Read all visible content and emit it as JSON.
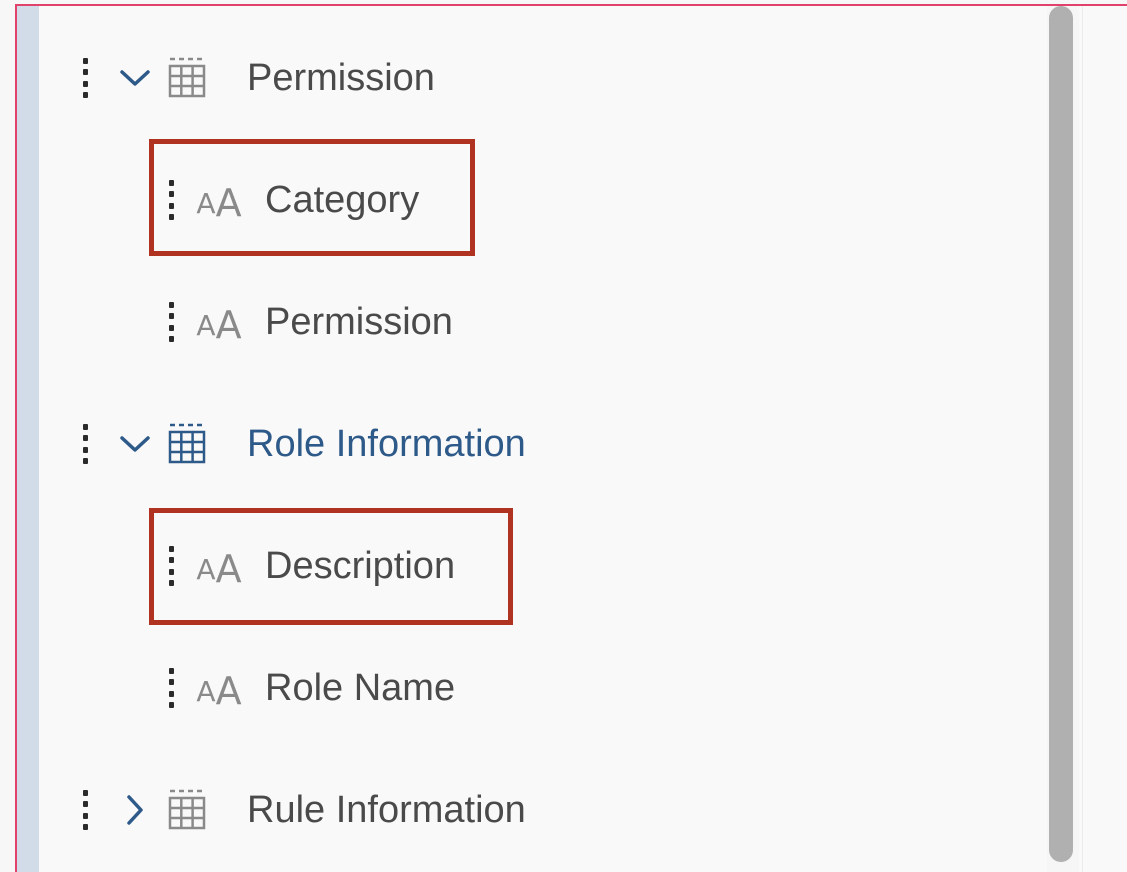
{
  "tree": {
    "items": [
      {
        "label": "Permission",
        "type": "table",
        "expanded": true,
        "color": "#4a4a4a"
      },
      {
        "label": "Category",
        "type": "text",
        "highlighted": true
      },
      {
        "label": "Permission",
        "type": "text"
      },
      {
        "label": "Role Information",
        "type": "table",
        "expanded": true,
        "color": "#2e5a8a"
      },
      {
        "label": "Description",
        "type": "text",
        "highlighted": true
      },
      {
        "label": "Role Name",
        "type": "text"
      },
      {
        "label": "Rule Information",
        "type": "table",
        "expanded": false,
        "color": "#4a4a4a"
      }
    ]
  },
  "colors": {
    "highlight_border": "#b03221",
    "accent_blue": "#2e5a8a",
    "left_stripe": "#d1dce8",
    "panel_border": "#e0426c"
  },
  "icons": {
    "drag": "drag-handle-icon",
    "expanded": "chevron-down-icon",
    "collapsed": "chevron-right-icon",
    "table": "table-icon",
    "text_field": "text-field-icon"
  }
}
